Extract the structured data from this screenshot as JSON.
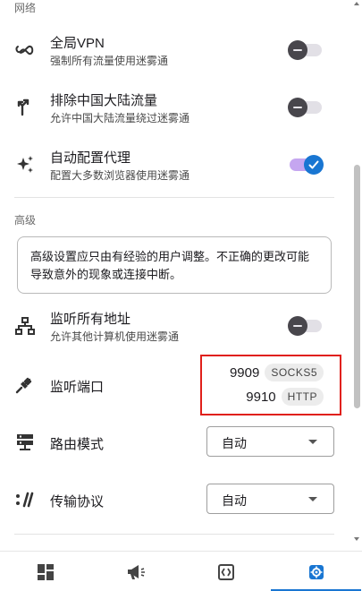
{
  "sections": {
    "network": "网络",
    "advanced": "高级"
  },
  "global_vpn": {
    "title": "全局VPN",
    "subtitle": "强制所有流量使用迷雾通",
    "enabled": false
  },
  "exclude_china": {
    "title": "排除中国大陆流量",
    "subtitle": "允许中国大陆流量绕过迷雾通",
    "enabled": false
  },
  "auto_proxy": {
    "title": "自动配置代理",
    "subtitle": "配置大多数浏览器使用迷雾通",
    "enabled": true
  },
  "advanced_note": "高级设置应只由有经验的用户调整。不正确的更改可能导致意外的现象或连接中断。",
  "listen_all": {
    "title": "监听所有地址",
    "subtitle": "允许其他计算机使用迷雾通",
    "enabled": false
  },
  "listen_port": {
    "title": "监听端口",
    "ports": [
      {
        "port": "9909",
        "protocol": "SOCKS5"
      },
      {
        "port": "9910",
        "protocol": "HTTP"
      }
    ]
  },
  "routing_mode": {
    "title": "路由模式",
    "value": "自动"
  },
  "transport": {
    "title": "传输协议",
    "value": "自动"
  },
  "bottom_nav": {
    "items": [
      {
        "icon": "dashboard-icon",
        "active": false
      },
      {
        "icon": "announcement-icon",
        "active": false
      },
      {
        "icon": "logs-icon",
        "active": false
      },
      {
        "icon": "settings-icon",
        "active": true
      }
    ]
  },
  "colors": {
    "accent": "#1976d2",
    "highlight_border": "#e0201b",
    "toggle_on_track": "#c5a6f0"
  }
}
